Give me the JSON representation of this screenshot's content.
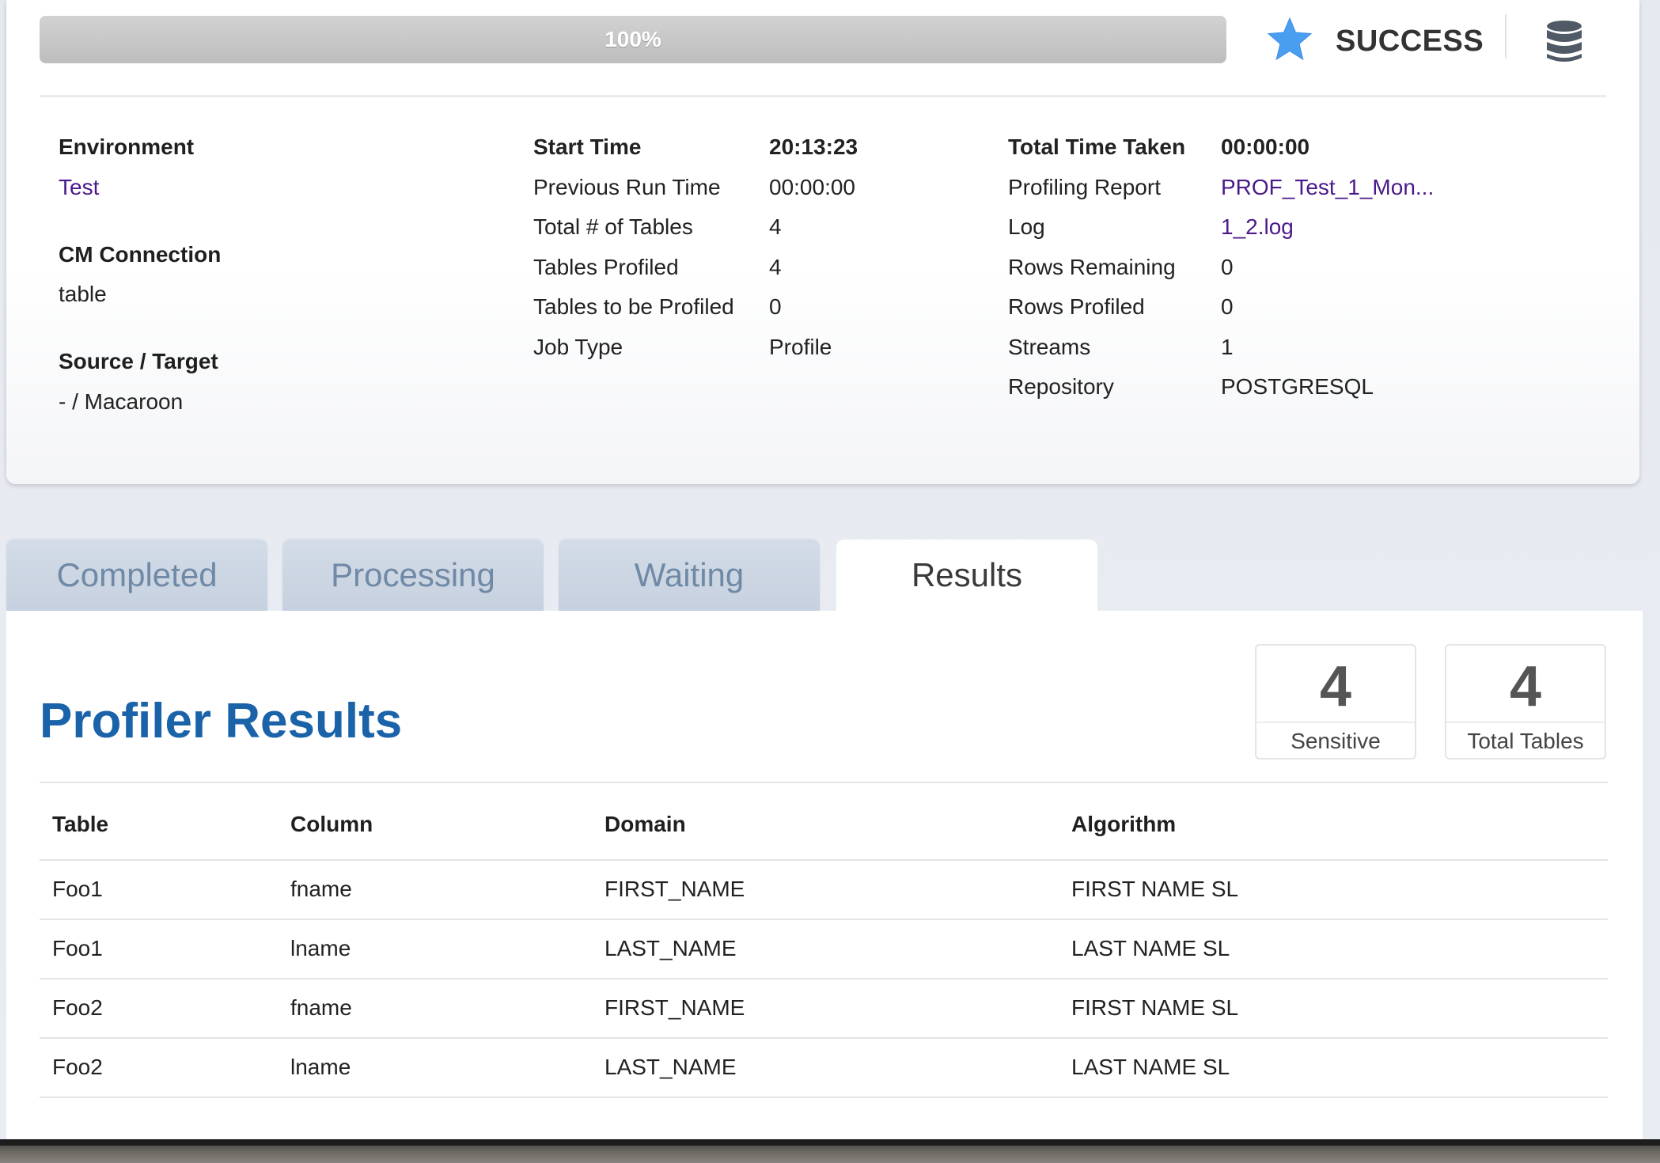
{
  "progress": {
    "value": 1.0,
    "label": "100%"
  },
  "status": {
    "text": "SUCCESS",
    "star_color": "#4a9ef0",
    "icon": "star-icon"
  },
  "database_icon": "database-icon",
  "summary": {
    "environment": {
      "label": "Environment",
      "value": "Test"
    },
    "cm_connection": {
      "label": "CM Connection",
      "value": "table"
    },
    "source_target": {
      "label": "Source / Target",
      "value": "- / Macaroon"
    },
    "middle": [
      {
        "label": "Start Time",
        "value": "20:13:23",
        "bold": true
      },
      {
        "label": "Previous Run Time",
        "value": "00:00:00"
      },
      {
        "label": "Total # of Tables",
        "value": "4"
      },
      {
        "label": "Tables Profiled",
        "value": "4"
      },
      {
        "label": "Tables to be Profiled",
        "value": "0"
      },
      {
        "label": "Job Type",
        "value": "Profile"
      }
    ],
    "right": [
      {
        "label": "Total Time Taken",
        "value": "00:00:00",
        "bold": true
      },
      {
        "label": "Profiling Report",
        "value": "PROF_Test_1_Mon...",
        "link": true
      },
      {
        "label": "Log",
        "value": "1_2.log",
        "link": true
      },
      {
        "label": "Rows Remaining",
        "value": "0"
      },
      {
        "label": "Rows Profiled",
        "value": "0"
      },
      {
        "label": "Streams",
        "value": "1"
      },
      {
        "label": "Repository",
        "value": "POSTGRESQL"
      }
    ]
  },
  "tabs": [
    {
      "label": "Completed",
      "active": false
    },
    {
      "label": "Processing",
      "active": false
    },
    {
      "label": "Waiting",
      "active": false
    },
    {
      "label": "Results",
      "active": true
    }
  ],
  "results": {
    "title": "Profiler Results",
    "stats": [
      {
        "number": "4",
        "label": "Sensitive"
      },
      {
        "number": "4",
        "label": "Total Tables"
      }
    ],
    "columns": [
      "Table",
      "Column",
      "Domain",
      "Algorithm"
    ],
    "rows": [
      [
        "Foo1",
        "fname",
        "FIRST_NAME",
        "FIRST NAME SL"
      ],
      [
        "Foo1",
        "lname",
        "LAST_NAME",
        "LAST NAME SL"
      ],
      [
        "Foo2",
        "fname",
        "FIRST_NAME",
        "FIRST NAME SL"
      ],
      [
        "Foo2",
        "lname",
        "LAST_NAME",
        "LAST NAME SL"
      ]
    ]
  },
  "colors": {
    "link": "#4a1a8a",
    "title": "#1a63a8",
    "tab_inactive_text": "#6f89a6"
  }
}
